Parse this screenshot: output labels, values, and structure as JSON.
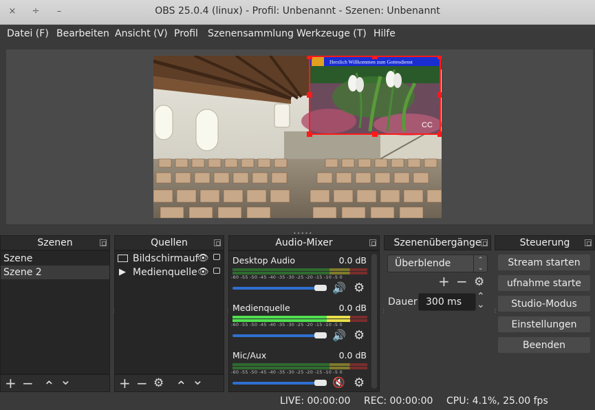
{
  "window": {
    "title": "OBS 25.0.4 (linux) - Profil: Unbenannt - Szenen: Unbenannt",
    "close_icon": "×",
    "restore_icon": "÷",
    "minimize_icon": "–"
  },
  "menu": {
    "file": "Datei (F)",
    "edit": "Bearbeiten",
    "view": "Ansicht (V)",
    "profile": "Profil",
    "scene_collection": "Szenensammlung",
    "tools": "Werkzeuge (T)",
    "help": "Hilfe"
  },
  "preview": {
    "overlay_banner": "Herzlich Willkommen zum Gottesdienst",
    "overlay_logo": "CC",
    "selection_color": "#ff1a1a"
  },
  "scenes": {
    "title": "Szenen",
    "items": [
      {
        "label": "Szene"
      },
      {
        "label": "Szene 2"
      }
    ],
    "toolbar": {
      "add": "+",
      "remove": "−",
      "up": "⌃",
      "down": "⌄"
    }
  },
  "sources": {
    "title": "Quellen",
    "items": [
      {
        "label": "Bildschirmauf",
        "icon": "monitor-icon"
      },
      {
        "label": "Medienquelle",
        "icon": "play-icon"
      }
    ],
    "toolbar": {
      "add": "+",
      "remove": "−",
      "settings": "⚙",
      "up": "⌃",
      "down": "⌄"
    }
  },
  "mixer": {
    "title": "Audio-Mixer",
    "scale": "-60 -55 -50 -45 -40 -35 -30 -25 -20 -15 -10 -5 0",
    "channels": [
      {
        "name": "Desktop Audio",
        "db": "0.0 dB",
        "muted": false,
        "level": 0.0
      },
      {
        "name": "Medienquelle",
        "db": "0.0 dB",
        "muted": false,
        "level": 0.87
      },
      {
        "name": "Mic/Aux",
        "db": "0.0 dB",
        "muted": true,
        "level": 0.0
      }
    ]
  },
  "transitions": {
    "title": "Szenenübergänge",
    "selected": "Überblende",
    "duration_label": "Dauer",
    "duration_value": "300 ms",
    "toolbar": {
      "add": "+",
      "remove": "−",
      "settings": "⚙"
    }
  },
  "controls": {
    "title": "Steuerung",
    "buttons": [
      "Stream starten",
      "ufnahme starte",
      "Studio-Modus",
      "Einstellungen",
      "Beenden"
    ]
  },
  "status": {
    "live": "LIVE: 00:00:00",
    "rec": "REC: 00:00:00",
    "cpu": "CPU: 4.1%, 25.00 fps"
  },
  "colors": {
    "accent_blue": "#2f6fcf",
    "muted_red": "#e0302a"
  }
}
